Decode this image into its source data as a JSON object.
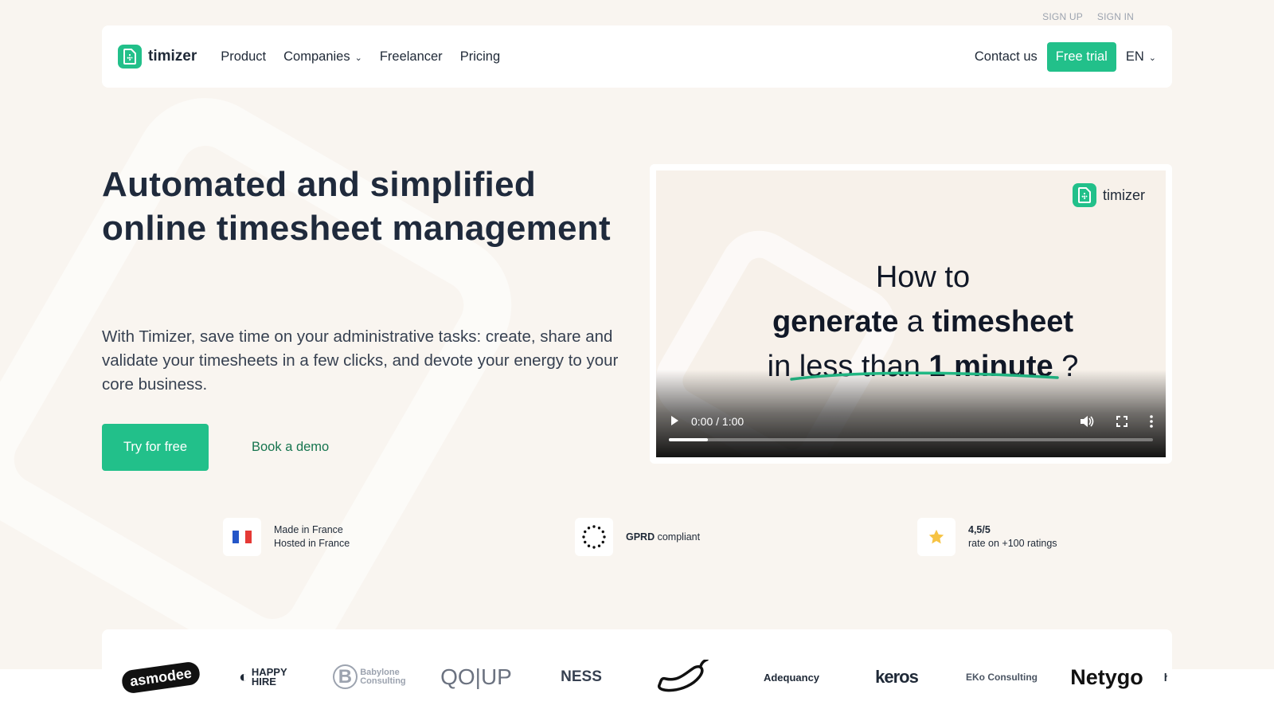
{
  "top_links": {
    "sign_up": "SIGN UP",
    "sign_in": "SIGN IN"
  },
  "brand": {
    "name": "timizer",
    "accent": "#22c08a"
  },
  "nav": {
    "items": [
      {
        "label": "Product"
      },
      {
        "label": "Companies",
        "dropdown": true
      },
      {
        "label": "Freelancer"
      },
      {
        "label": "Pricing"
      }
    ],
    "contact": "Contact us",
    "free_trial": "Free trial",
    "language": "EN"
  },
  "hero": {
    "title": "Automated and simplified online timesheet management",
    "subtitle": "With Timizer, save time on your administrative tasks: create, share and validate your timesheets in a few clicks, and devote your energy to your core business.",
    "cta_primary": "Try for free",
    "cta_secondary": "Book a demo"
  },
  "video": {
    "brand": "timizer",
    "line1": "How to",
    "line2_bold1": "generate",
    "line2_mid": " a ",
    "line2_bold2": "timesheet",
    "line3_pre": "in less than ",
    "line3_bold": "1 minute",
    "line3_post": " ?",
    "time": "0:00 / 1:00",
    "progress": 0.08
  },
  "badges": [
    {
      "icon": "france-flag-icon",
      "line1": "Made in France",
      "line2": "Hosted in France"
    },
    {
      "icon": "eu-stars-icon",
      "bold": "GPRD",
      "rest": " compliant"
    },
    {
      "icon": "star-icon",
      "line1": "4,5/5",
      "line2": "rate on +100 ratings"
    }
  ],
  "clients": [
    "asmodee",
    "HAPPY HIRE",
    "Babylone Consulting",
    "QO|UP",
    "NESS",
    "pepper-logo",
    "Adequancy",
    "keros",
    "EKo Consulting",
    "Netygo",
    "h"
  ]
}
